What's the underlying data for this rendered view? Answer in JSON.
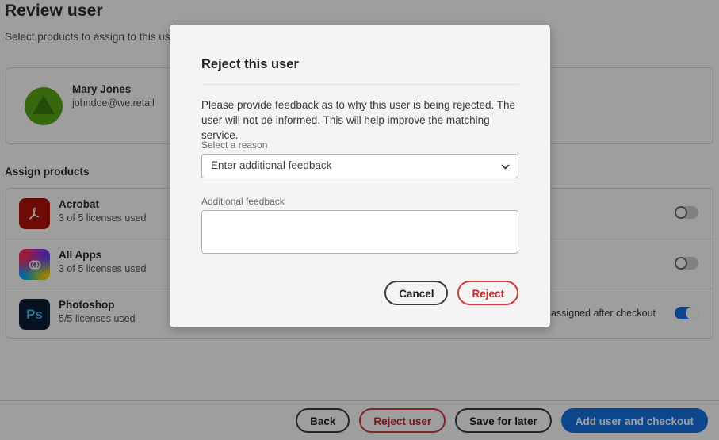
{
  "page": {
    "title": "Review user",
    "subtitle": "Select products to assign to this user",
    "section_title": "Assign products"
  },
  "user_card": {
    "name": "Mary Jones",
    "email": "johndoe@we.retail",
    "avatar_name": "avatar",
    "avatar_bg": "#5aa916",
    "avatar_fg": "#3d7a0f"
  },
  "products": [
    {
      "name": "Acrobat",
      "licenses": "3 of 5 licenses used",
      "icon": "acrobat-icon",
      "icon_glyph": "⤵",
      "icon_class": "icon-acrobat",
      "toggle_on": false,
      "note": ""
    },
    {
      "name": "All Apps",
      "licenses": "3 of 5 licenses used",
      "icon": "all-apps-icon",
      "icon_glyph": "Ⓒ",
      "icon_class": "icon-allapps",
      "toggle_on": false,
      "note": ""
    },
    {
      "name": "Photoshop",
      "licenses": "5/5 licenses used",
      "icon": "photoshop-icon",
      "icon_glyph": "Ps",
      "icon_class": "icon-photoshop",
      "toggle_on": true,
      "note": "ill be assigned after checkout"
    }
  ],
  "footer": {
    "back_label": "Back",
    "reject_user_label": "Reject user",
    "save_for_later_label": "Save for later",
    "add_user_checkout_label": "Add user and checkout"
  },
  "modal": {
    "title": "Reject this user",
    "body": "Please provide feedback as to why this user is being rejected. The user will not be informed. This will help improve the matching service.",
    "reason_label": "Select a reason",
    "reason_value": "Enter additional feedback",
    "feedback_label": "Additional feedback",
    "feedback_value": "",
    "feedback_placeholder": "",
    "cancel_label": "Cancel",
    "reject_label": "Reject"
  },
  "colors": {
    "accent_blue": "#1473e6",
    "danger_red": "#d7373f",
    "scrim": "rgba(0,0,0,0.38)",
    "modal_bg": "#f4f4f4"
  }
}
